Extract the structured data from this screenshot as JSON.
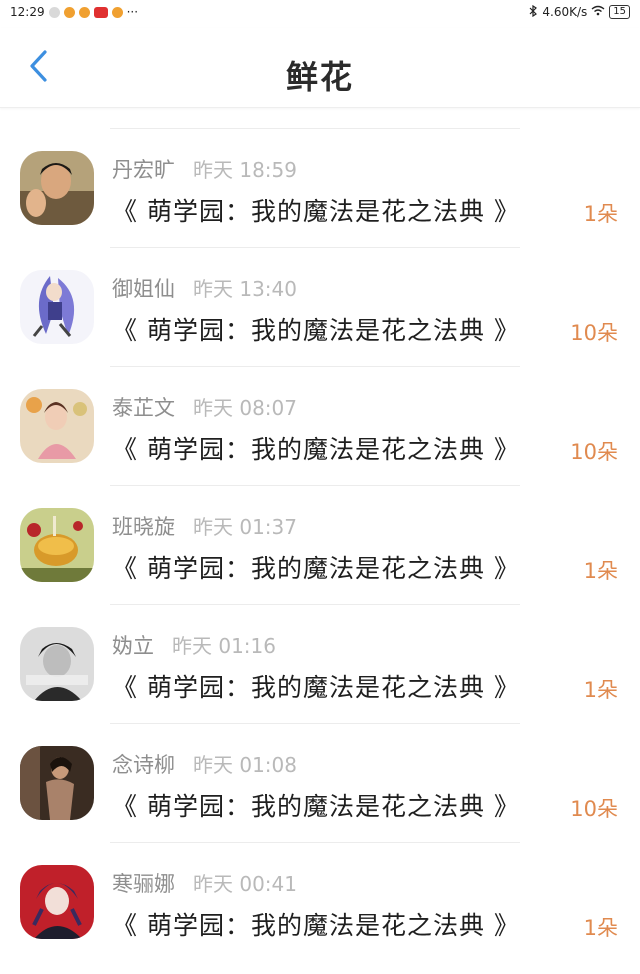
{
  "status_bar": {
    "time": "12:29",
    "more": "···",
    "network_speed": "4.60K/s",
    "battery": "15"
  },
  "header": {
    "title": "鲜花",
    "back_icon": "chevron-left-icon"
  },
  "colors": {
    "accent_back": "#3d8fe0",
    "flower_count": "#e08a4f"
  },
  "items": [
    {
      "name": "丹宏旷",
      "time": "昨天 18:59",
      "book": "《 萌学园：我的魔法是花之法典 》",
      "count": "1朵"
    },
    {
      "name": "御姐仙",
      "time": "昨天 13:40",
      "book": "《 萌学园：我的魔法是花之法典 》",
      "count": "10朵"
    },
    {
      "name": "泰芷文",
      "time": "昨天 08:07",
      "book": "《 萌学园：我的魔法是花之法典 》",
      "count": "10朵"
    },
    {
      "name": "班晓旋",
      "time": "昨天 01:37",
      "book": "《 萌学园：我的魔法是花之法典 》",
      "count": "1朵"
    },
    {
      "name": "妫立",
      "time": "昨天 01:16",
      "book": "《 萌学园：我的魔法是花之法典 》",
      "count": "1朵"
    },
    {
      "name": "念诗柳",
      "time": "昨天 01:08",
      "book": "《 萌学园：我的魔法是花之法典 》",
      "count": "10朵"
    },
    {
      "name": "寒骊娜",
      "time": "昨天 00:41",
      "book": "《 萌学园：我的魔法是花之法典 》",
      "count": "1朵"
    }
  ]
}
